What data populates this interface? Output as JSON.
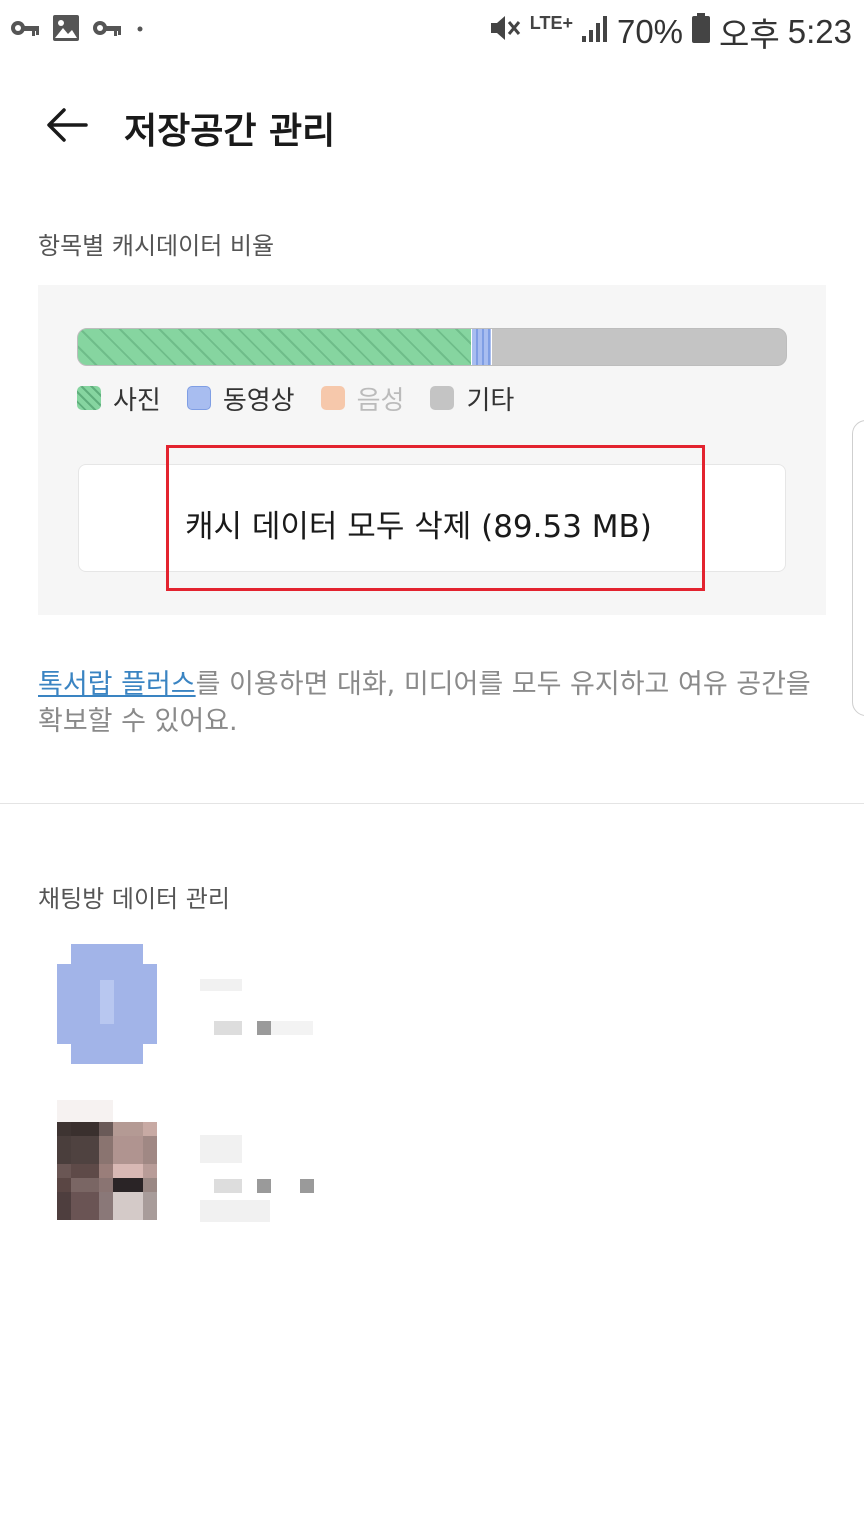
{
  "status_bar": {
    "battery_percent": "70%",
    "ampm": "오후",
    "time": "5:23",
    "network": "LTE+",
    "left_icons": [
      "key-icon",
      "image-icon",
      "key-icon",
      "dot-icon"
    ],
    "right_icons": [
      "mute-icon",
      "signal-icon",
      "battery-icon"
    ]
  },
  "header": {
    "title": "저장공간 관리",
    "back_icon": "arrow-left-icon"
  },
  "cache_section": {
    "label": "항목별 캐시데이터 비율",
    "ratio_bar": [
      {
        "name": "사진",
        "fraction": 0.555,
        "color": "#86d5a0"
      },
      {
        "name": "동영상",
        "fraction": 0.03,
        "color": "#a8bdf0"
      },
      {
        "name": "음성",
        "fraction": 0.0,
        "color": "#f6c8ab"
      },
      {
        "name": "기타",
        "fraction": 0.415,
        "color": "#c4c4c4"
      }
    ],
    "legend": {
      "photo": "사진",
      "video": "동영상",
      "audio": "음성",
      "other": "기타"
    },
    "clear_button_label": "캐시 데이터 모두 삭제 (89.53 MB)"
  },
  "description": {
    "link": "톡서랍 플러스",
    "text": "를 이용하면 대화, 미디어를 모두 유지하고 여유 공간을 확보할 수 있어요."
  },
  "chatroom_section": {
    "label": "채팅방 데이터 관리"
  }
}
